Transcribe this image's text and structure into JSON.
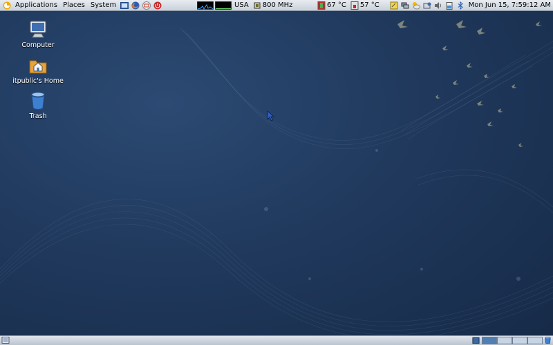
{
  "top_panel": {
    "menus": [
      "Applications",
      "Places",
      "System"
    ],
    "keyboard_layout": "USA",
    "cpu_freq": "800 MHz",
    "temp1": "67 °C",
    "temp2": "57 °C",
    "clock": "Mon Jun 15,  7:59:12 AM"
  },
  "desktop": {
    "icons": [
      {
        "label": "Computer",
        "icon": "computer-icon"
      },
      {
        "label": "itpublic's Home",
        "icon": "home-folder-icon"
      },
      {
        "label": "Trash",
        "icon": "trash-icon"
      }
    ]
  },
  "bottom_panel": {
    "workspace_count": 4,
    "active_workspace": 1
  },
  "colors": {
    "panel": "#d6dce4",
    "wallpaper": "#20395d",
    "accent": "#3b6aa0"
  }
}
